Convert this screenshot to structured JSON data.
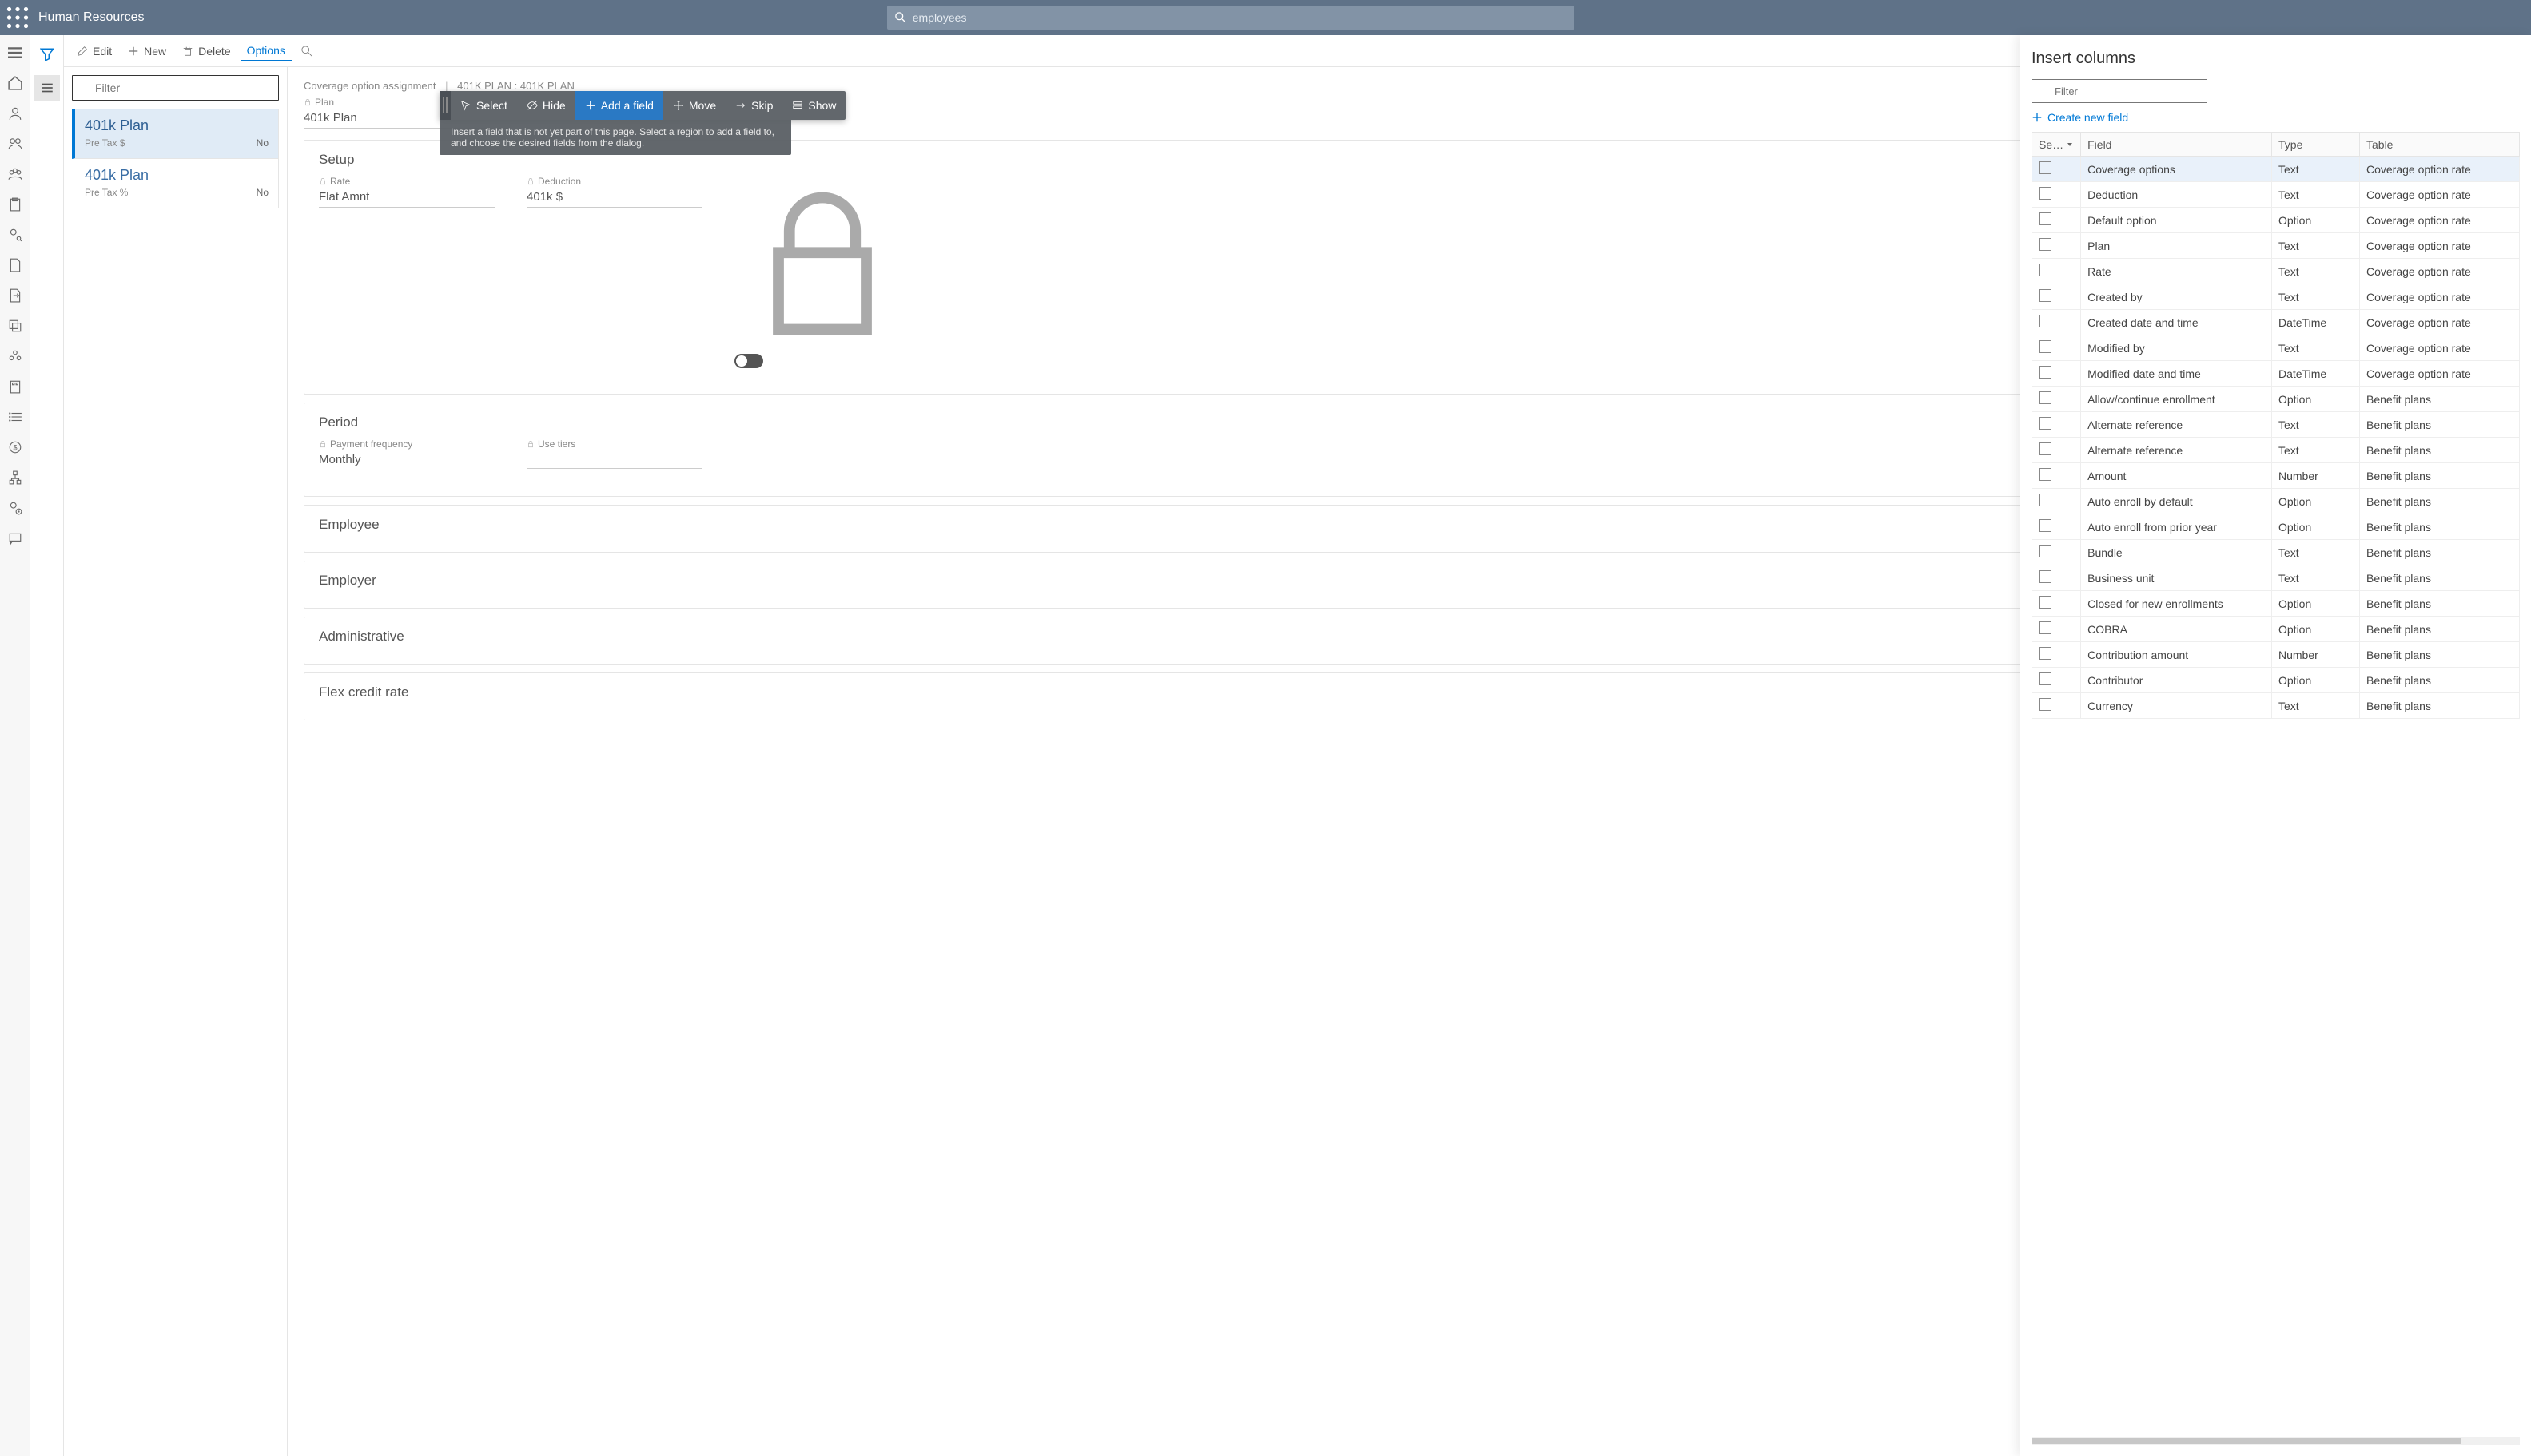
{
  "header": {
    "app_title": "Human Resources",
    "search_text": "employees"
  },
  "toolbar": {
    "edit": "Edit",
    "new": "New",
    "delete": "Delete",
    "options": "Options"
  },
  "list": {
    "filter_placeholder": "Filter",
    "items": [
      {
        "title": "401k Plan",
        "sub": "Pre Tax $",
        "right": "No"
      },
      {
        "title": "401k Plan",
        "sub": "Pre Tax %",
        "right": "No"
      }
    ]
  },
  "detail": {
    "breadcrumb_left": "Coverage option assignment",
    "breadcrumb_right": "401K PLAN : 401K PLAN",
    "plan_label": "Plan",
    "plan_value": "401k Plan",
    "sections": {
      "setup": {
        "title": "Setup",
        "rate_label": "Rate",
        "rate_value": "Flat Amnt",
        "deduction_label": "Deduction",
        "deduction_value": "401k $"
      },
      "period": {
        "title": "Period",
        "freq_label": "Payment frequency",
        "freq_value": "Monthly",
        "tiers_label": "Use tiers"
      },
      "employee": {
        "title": "Employee"
      },
      "employer": {
        "title": "Employer"
      },
      "administrative": {
        "title": "Administrative"
      },
      "flex": {
        "title": "Flex credit rate"
      }
    }
  },
  "float_toolbar": {
    "select": "Select",
    "hide": "Hide",
    "add": "Add a field",
    "move": "Move",
    "skip": "Skip",
    "show": "Show",
    "tooltip": "Insert a field that is not yet part of this page. Select a region to add a field to, and choose the desired fields from the dialog."
  },
  "insert_panel": {
    "title": "Insert columns",
    "filter_placeholder": "Filter",
    "create_link": "Create new field",
    "headers": {
      "sel": "Se…",
      "field": "Field",
      "type": "Type",
      "table": "Table"
    },
    "rows": [
      {
        "field": "Coverage options",
        "type": "Text",
        "table": "Coverage option rate"
      },
      {
        "field": "Deduction",
        "type": "Text",
        "table": "Coverage option rate"
      },
      {
        "field": "Default option",
        "type": "Option",
        "table": "Coverage option rate"
      },
      {
        "field": "Plan",
        "type": "Text",
        "table": "Coverage option rate"
      },
      {
        "field": "Rate",
        "type": "Text",
        "table": "Coverage option rate"
      },
      {
        "field": "Created by",
        "type": "Text",
        "table": "Coverage option rate"
      },
      {
        "field": "Created date and time",
        "type": "DateTime",
        "table": "Coverage option rate"
      },
      {
        "field": "Modified by",
        "type": "Text",
        "table": "Coverage option rate"
      },
      {
        "field": "Modified date and time",
        "type": "DateTime",
        "table": "Coverage option rate"
      },
      {
        "field": "Allow/continue enrollment",
        "type": "Option",
        "table": "Benefit plans"
      },
      {
        "field": "Alternate reference",
        "type": "Text",
        "table": "Benefit plans"
      },
      {
        "field": "Alternate reference",
        "type": "Text",
        "table": "Benefit plans"
      },
      {
        "field": "Amount",
        "type": "Number",
        "table": "Benefit plans"
      },
      {
        "field": "Auto enroll by default",
        "type": "Option",
        "table": "Benefit plans"
      },
      {
        "field": "Auto enroll from prior year",
        "type": "Option",
        "table": "Benefit plans"
      },
      {
        "field": "Bundle",
        "type": "Text",
        "table": "Benefit plans"
      },
      {
        "field": "Business unit",
        "type": "Text",
        "table": "Benefit plans"
      },
      {
        "field": "Closed for new enrollments",
        "type": "Option",
        "table": "Benefit plans"
      },
      {
        "field": "COBRA",
        "type": "Option",
        "table": "Benefit plans"
      },
      {
        "field": "Contribution amount",
        "type": "Number",
        "table": "Benefit plans"
      },
      {
        "field": "Contributor",
        "type": "Option",
        "table": "Benefit plans"
      },
      {
        "field": "Currency",
        "type": "Text",
        "table": "Benefit plans"
      }
    ]
  }
}
